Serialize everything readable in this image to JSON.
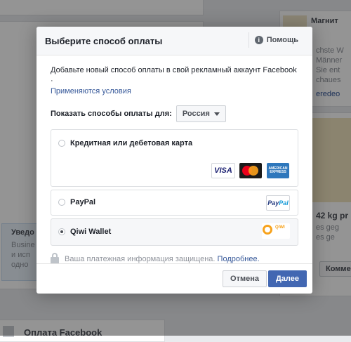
{
  "background": {
    "right_title": "Магнит",
    "right_lines": [
      "chste W",
      "Männer",
      "Sie ent",
      "chaues",
      "eredeo"
    ],
    "right_stat": "42 kg pr",
    "right_stat_sub": "es geg",
    "right_stat_sub2": "es ge",
    "right_button": "Коммен",
    "left_bottom_title": "Оплата Facebook",
    "left_notice": "Уведо",
    "left_notice_lines": [
      "Busine",
      "и исп",
      "одно"
    ]
  },
  "dialog": {
    "title": "Выберите способ оплаты",
    "help_label": "Помощь",
    "description": "Добавьте новый способ оплаты в свой рекламный аккаунт Facebook ·",
    "terms_link": "Применяются условия",
    "country_label": "Показать способы оплаты для:",
    "country_value": "Россия",
    "options": [
      {
        "label": "Кредитная или дебетовая карта",
        "selected": false
      },
      {
        "label": "PayPal",
        "selected": false
      },
      {
        "label": "Qiwi Wallet",
        "selected": true
      }
    ],
    "card_logos": {
      "visa": "VISA",
      "amex_top": "AMERICAN",
      "amex_bottom": "EXPRESS"
    },
    "paypal_logo": {
      "part1": "Pay",
      "part2": "Pal"
    },
    "qiwi_logo": "QIWI",
    "secure_text": "Ваша платежная информация защищена.",
    "secure_link": "Подробнее.",
    "cancel_label": "Отмена",
    "next_label": "Далее"
  }
}
